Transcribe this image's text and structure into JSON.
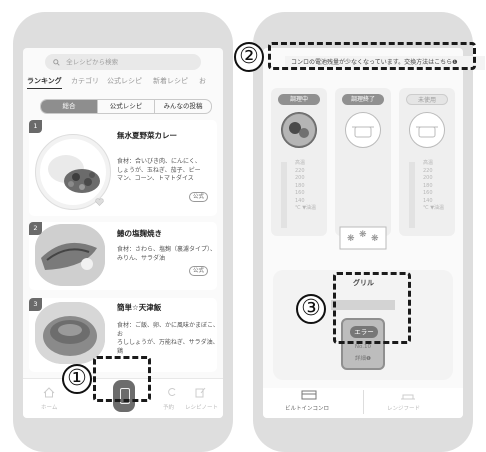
{
  "left_phone": {
    "search_placeholder": "全レシピから検索",
    "tabs": [
      "ランキング",
      "カテゴリ",
      "公式レシピ",
      "新着レシピ",
      "お"
    ],
    "segments": [
      "総合",
      "公式レシピ",
      "みんなの投稿"
    ],
    "cards": [
      {
        "rank": "1",
        "title": "無水夏野菜カレー",
        "desc": [
          "食材：合いびき肉、にんにく、",
          "しょうが、玉ねぎ、茄子、ピー",
          "マン、コーン、トマトダイス"
        ],
        "badge": "公式"
      },
      {
        "rank": "2",
        "title": "鰆の塩麹焼き",
        "desc": [
          "食材：さわら、塩麹（裏濾タイプ）、",
          "みりん、サラダ油"
        ],
        "badge": "公式"
      },
      {
        "rank": "3",
        "title": "簡単☆天津飯",
        "desc": [
          "食材：ご飯、卵、かに風味かまぼこ、お",
          "ろししょうが、万能ねぎ、サラダ油、鶏"
        ],
        "badge": ""
      }
    ],
    "bottom_nav": [
      "ホーム",
      "",
      "予約",
      "レシピノート"
    ]
  },
  "right_phone": {
    "notice": "コンロの電池残量が少なくなっています。交換方法はこちら❶",
    "burners": [
      {
        "status": "調理中"
      },
      {
        "status": "調理終了"
      },
      {
        "status": "未使用"
      }
    ],
    "temps": [
      "高温",
      "220",
      "200",
      "180",
      "160",
      "140"
    ],
    "temp_unit": "℃ ▼油温",
    "grill_label": "グリル",
    "error": {
      "label": "エラー",
      "code": "No.10",
      "detail": "詳細❶"
    },
    "bottom_nav": [
      "ビルトインコンロ",
      "レンジフード"
    ]
  },
  "callouts": [
    "①",
    "②",
    "③"
  ],
  "colors": {
    "dash": "#1a1a1a",
    "phone": "#dedede"
  }
}
